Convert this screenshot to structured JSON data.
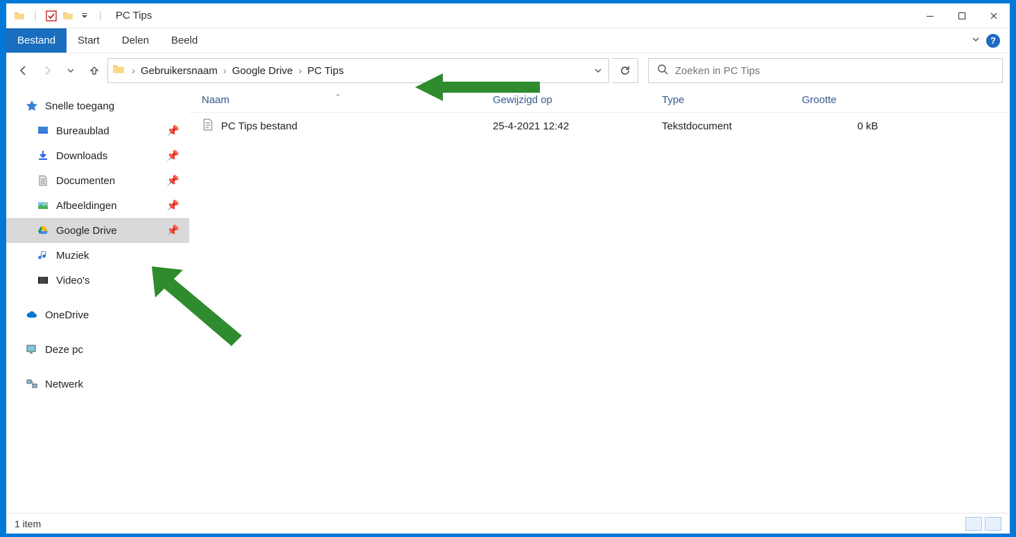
{
  "window": {
    "title": "PC Tips"
  },
  "ribbon": {
    "file": "Bestand",
    "tabs": [
      "Start",
      "Delen",
      "Beeld"
    ]
  },
  "breadcrumb": [
    "Gebruikersnaam",
    "Google Drive",
    "PC Tips"
  ],
  "search": {
    "placeholder": "Zoeken in PC Tips"
  },
  "columns": {
    "name": "Naam",
    "modified": "Gewijzigd op",
    "type": "Type",
    "size": "Grootte"
  },
  "sidebar": {
    "quick_access": "Snelle toegang",
    "items": [
      {
        "label": "Bureaublad",
        "pinned": true
      },
      {
        "label": "Downloads",
        "pinned": true
      },
      {
        "label": "Documenten",
        "pinned": true
      },
      {
        "label": "Afbeeldingen",
        "pinned": true
      },
      {
        "label": "Google Drive",
        "pinned": true,
        "selected": true
      },
      {
        "label": "Muziek",
        "pinned": false
      },
      {
        "label": "Video's",
        "pinned": false
      }
    ],
    "onedrive": "OneDrive",
    "thispc": "Deze pc",
    "network": "Netwerk"
  },
  "files": [
    {
      "name": "PC Tips bestand",
      "modified": "25-4-2021 12:42",
      "type": "Tekstdocument",
      "size": "0 kB"
    }
  ],
  "status": {
    "item_count": "1 item"
  }
}
